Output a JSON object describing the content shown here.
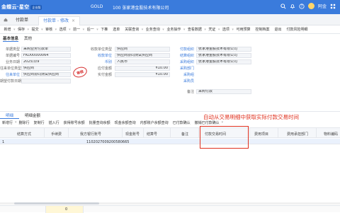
{
  "app": {
    "logo_text": "金蝶云·星空",
    "edition_badge": "企业版",
    "gold_label": "GOLD",
    "org": "100 张家港金股技术有限公司",
    "user": "阿金"
  },
  "tabs": [
    {
      "label": "付款单"
    },
    {
      "label": "付款单 - 修改",
      "close": "×"
    }
  ],
  "toolbar": [
    "新增",
    "保存",
    "提交",
    "审核",
    "选项",
    "前一",
    "后一",
    "下推",
    "选单",
    "关联查询",
    "业务查询",
    "业务操作",
    "查看数据",
    "凭证",
    "选项",
    "可用预算",
    "控制档案",
    "退出",
    "付款风险明细"
  ],
  "form_tabs": [
    "基本信息",
    "其他"
  ],
  "form": {
    "left": [
      {
        "label": "单据类型",
        "value": "采购业务付款单"
      },
      {
        "label": "单据编号",
        "value": "FKD00000064"
      },
      {
        "label": "业务日期",
        "value": "2025/3/9"
      },
      {
        "label": "往来单位类型",
        "value": "供应商"
      },
      {
        "label": "往来单位",
        "value": "供应商协同测试供应商"
      },
      {
        "label": "期望付款日期",
        "value": ""
      }
    ],
    "mid": [
      {
        "label": "收款单位类型",
        "value": "供应商"
      },
      {
        "label": "收款单位",
        "value": "供应商协同测试供应商"
      },
      {
        "label": "币别",
        "value": "人民币"
      },
      {
        "label": "应付金额",
        "value": "¥10.00"
      },
      {
        "label": "实付金额",
        "value": "¥10.00"
      }
    ],
    "right": [
      {
        "label": "付款组织",
        "value": "张家港金股技术有限公司"
      },
      {
        "label": "结算组织",
        "value": "张家港金股技术有限公司"
      },
      {
        "label": "采购组织",
        "value": "张家港金股技术有限公司"
      },
      {
        "label": "采购部门",
        "value": ""
      },
      {
        "label": "采购组",
        "value": ""
      },
      {
        "label": "采购员",
        "value": ""
      },
      {
        "label": "备注",
        "value": "采购付款"
      }
    ],
    "stamp": "审核"
  },
  "grid_tabs": [
    "明细",
    "明细金额"
  ],
  "grid_toolbar": [
    "新增行",
    "删除行",
    "复制行",
    "插入行",
    "获得账号余额",
    "批量查询余额",
    "现金余额查询",
    "内部账户余额查询",
    "已付款确认",
    "撤销已付款确认"
  ],
  "annotation": "自动从交易明细中获取实际付款交易时间",
  "table": {
    "headers": [
      "结算方式",
      "手续费",
      "我方银行账号",
      "现金账号",
      "结算号",
      "备注",
      "付款交易时间",
      "费用项目",
      "费用承担部门",
      "物料编码"
    ],
    "row": {
      "num": "1",
      "account": "1102027009200580665"
    }
  },
  "footer": {
    "sum": "0"
  }
}
